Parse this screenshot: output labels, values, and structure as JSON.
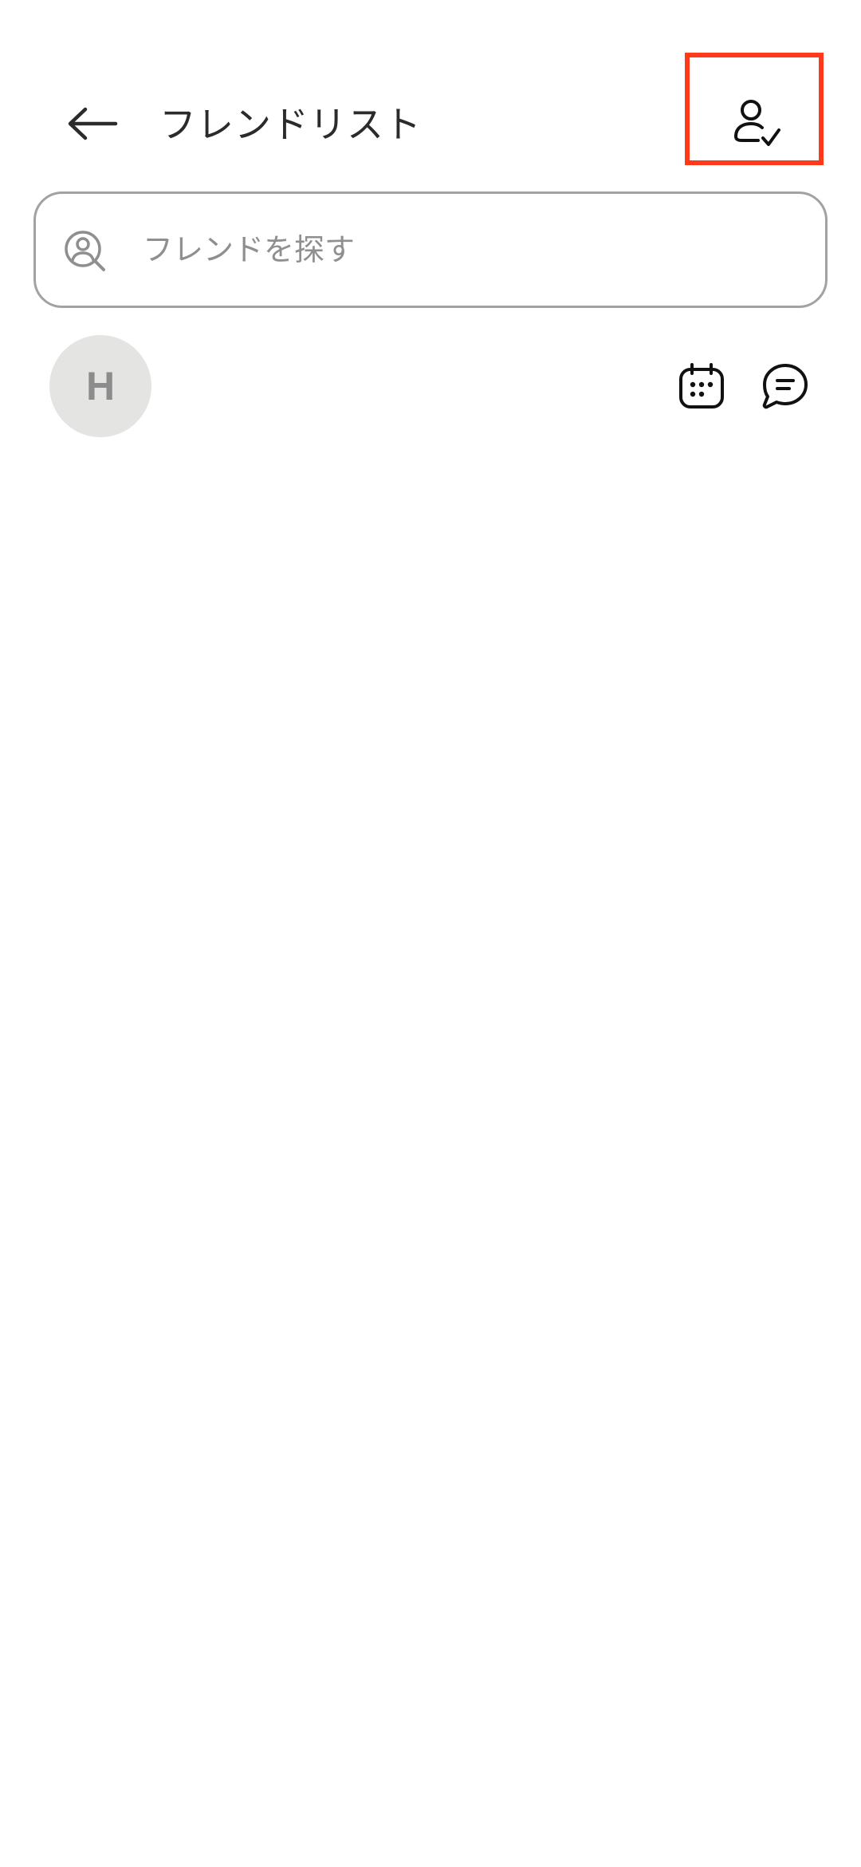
{
  "header": {
    "title": "フレンドリスト",
    "back_icon": "arrow-left-icon",
    "friend_request_icon": "user-check-icon",
    "highlight_color": "#ff3a1a"
  },
  "search": {
    "placeholder": "フレンドを探す",
    "value": "",
    "icon": "user-search-icon"
  },
  "friends": [
    {
      "avatar_initial": "H",
      "name": "",
      "actions": [
        "calendar-icon",
        "message-icon"
      ]
    }
  ]
}
